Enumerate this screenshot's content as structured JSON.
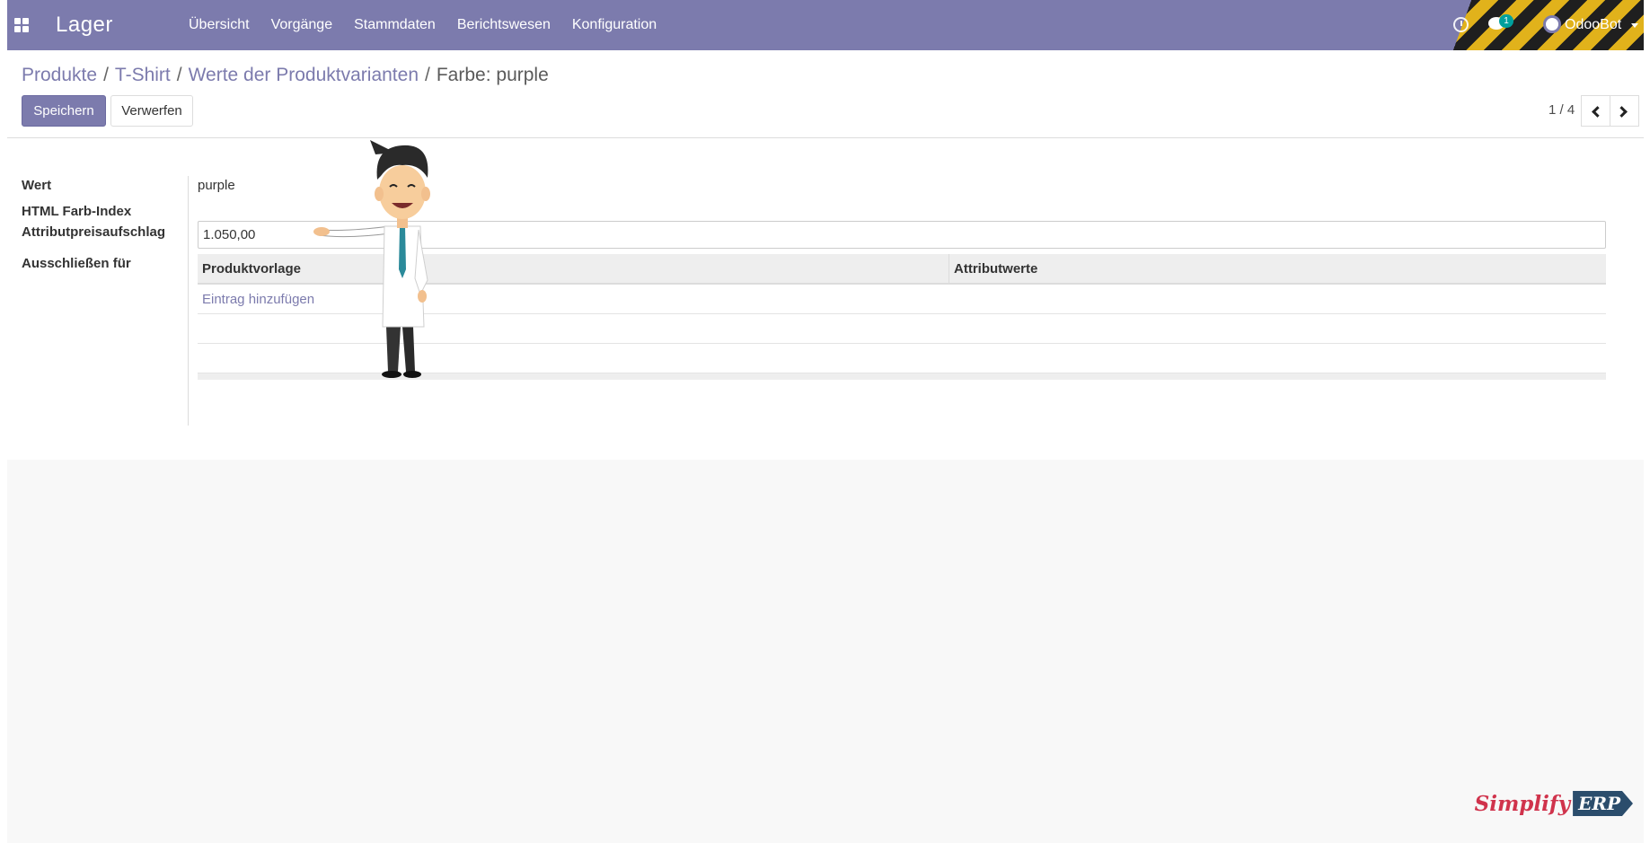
{
  "navbar": {
    "app_title": "Lager",
    "menu": [
      "Übersicht",
      "Vorgänge",
      "Stammdaten",
      "Berichtswesen",
      "Konfiguration"
    ],
    "chat_count": "1",
    "user_name": "OdooBot",
    "background_color": "#7c7bad"
  },
  "breadcrumb": {
    "items": [
      "Produkte",
      "T-Shirt",
      "Werte der Produktvarianten"
    ],
    "active": "Farbe: purple",
    "separator": "/"
  },
  "buttons": {
    "save": "Speichern",
    "discard": "Verwerfen"
  },
  "pager": {
    "value": "1 / 4"
  },
  "form": {
    "labels": {
      "value": "Wert",
      "html_color": "HTML Farb-Index",
      "price_extra": "Attributpreisaufschlag",
      "exclude_for": "Ausschließen für"
    },
    "value": "purple",
    "price_extra": "1.050,00",
    "exclude_table": {
      "columns": [
        "Produktvorlage",
        "Attributwerte"
      ],
      "add_line": "Eintrag hinzufügen"
    }
  },
  "watermark": {
    "brand_text": "Simplify",
    "brand_badge": "ERP"
  },
  "icons": {
    "apps": "apps-grid-icon",
    "activity": "clock-icon",
    "messages": "chat-icon",
    "pager_prev": "chevron-left-icon",
    "pager_next": "chevron-right-icon"
  }
}
